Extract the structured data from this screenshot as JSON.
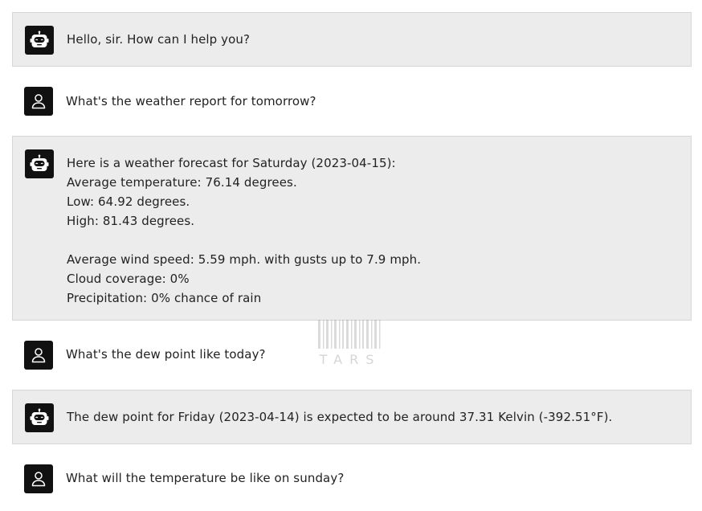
{
  "watermark": {
    "text": "TARS"
  },
  "messages": [
    {
      "role": "bot",
      "avatar_icon": "robot-icon",
      "text": "Hello, sir. How can I help you?"
    },
    {
      "role": "user",
      "avatar_icon": "user-icon",
      "text": "What's the weather report for tomorrow?"
    },
    {
      "role": "bot",
      "avatar_icon": "robot-icon",
      "text": "Here is a weather forecast for Saturday (2023-04-15):\nAverage temperature: 76.14 degrees.\nLow: 64.92 degrees.\nHigh: 81.43 degrees.\n\nAverage wind speed: 5.59 mph. with gusts up to 7.9 mph.\nCloud coverage: 0%\nPrecipitation: 0% chance of rain"
    },
    {
      "role": "user",
      "avatar_icon": "user-icon",
      "text": "What's the dew point like today?"
    },
    {
      "role": "bot",
      "avatar_icon": "robot-icon",
      "text": "The dew point for Friday (2023-04-14) is expected to be around 37.31 Kelvin (-392.51°F)."
    },
    {
      "role": "user",
      "avatar_icon": "user-icon",
      "text": "What will the temperature be like on sunday?"
    }
  ]
}
